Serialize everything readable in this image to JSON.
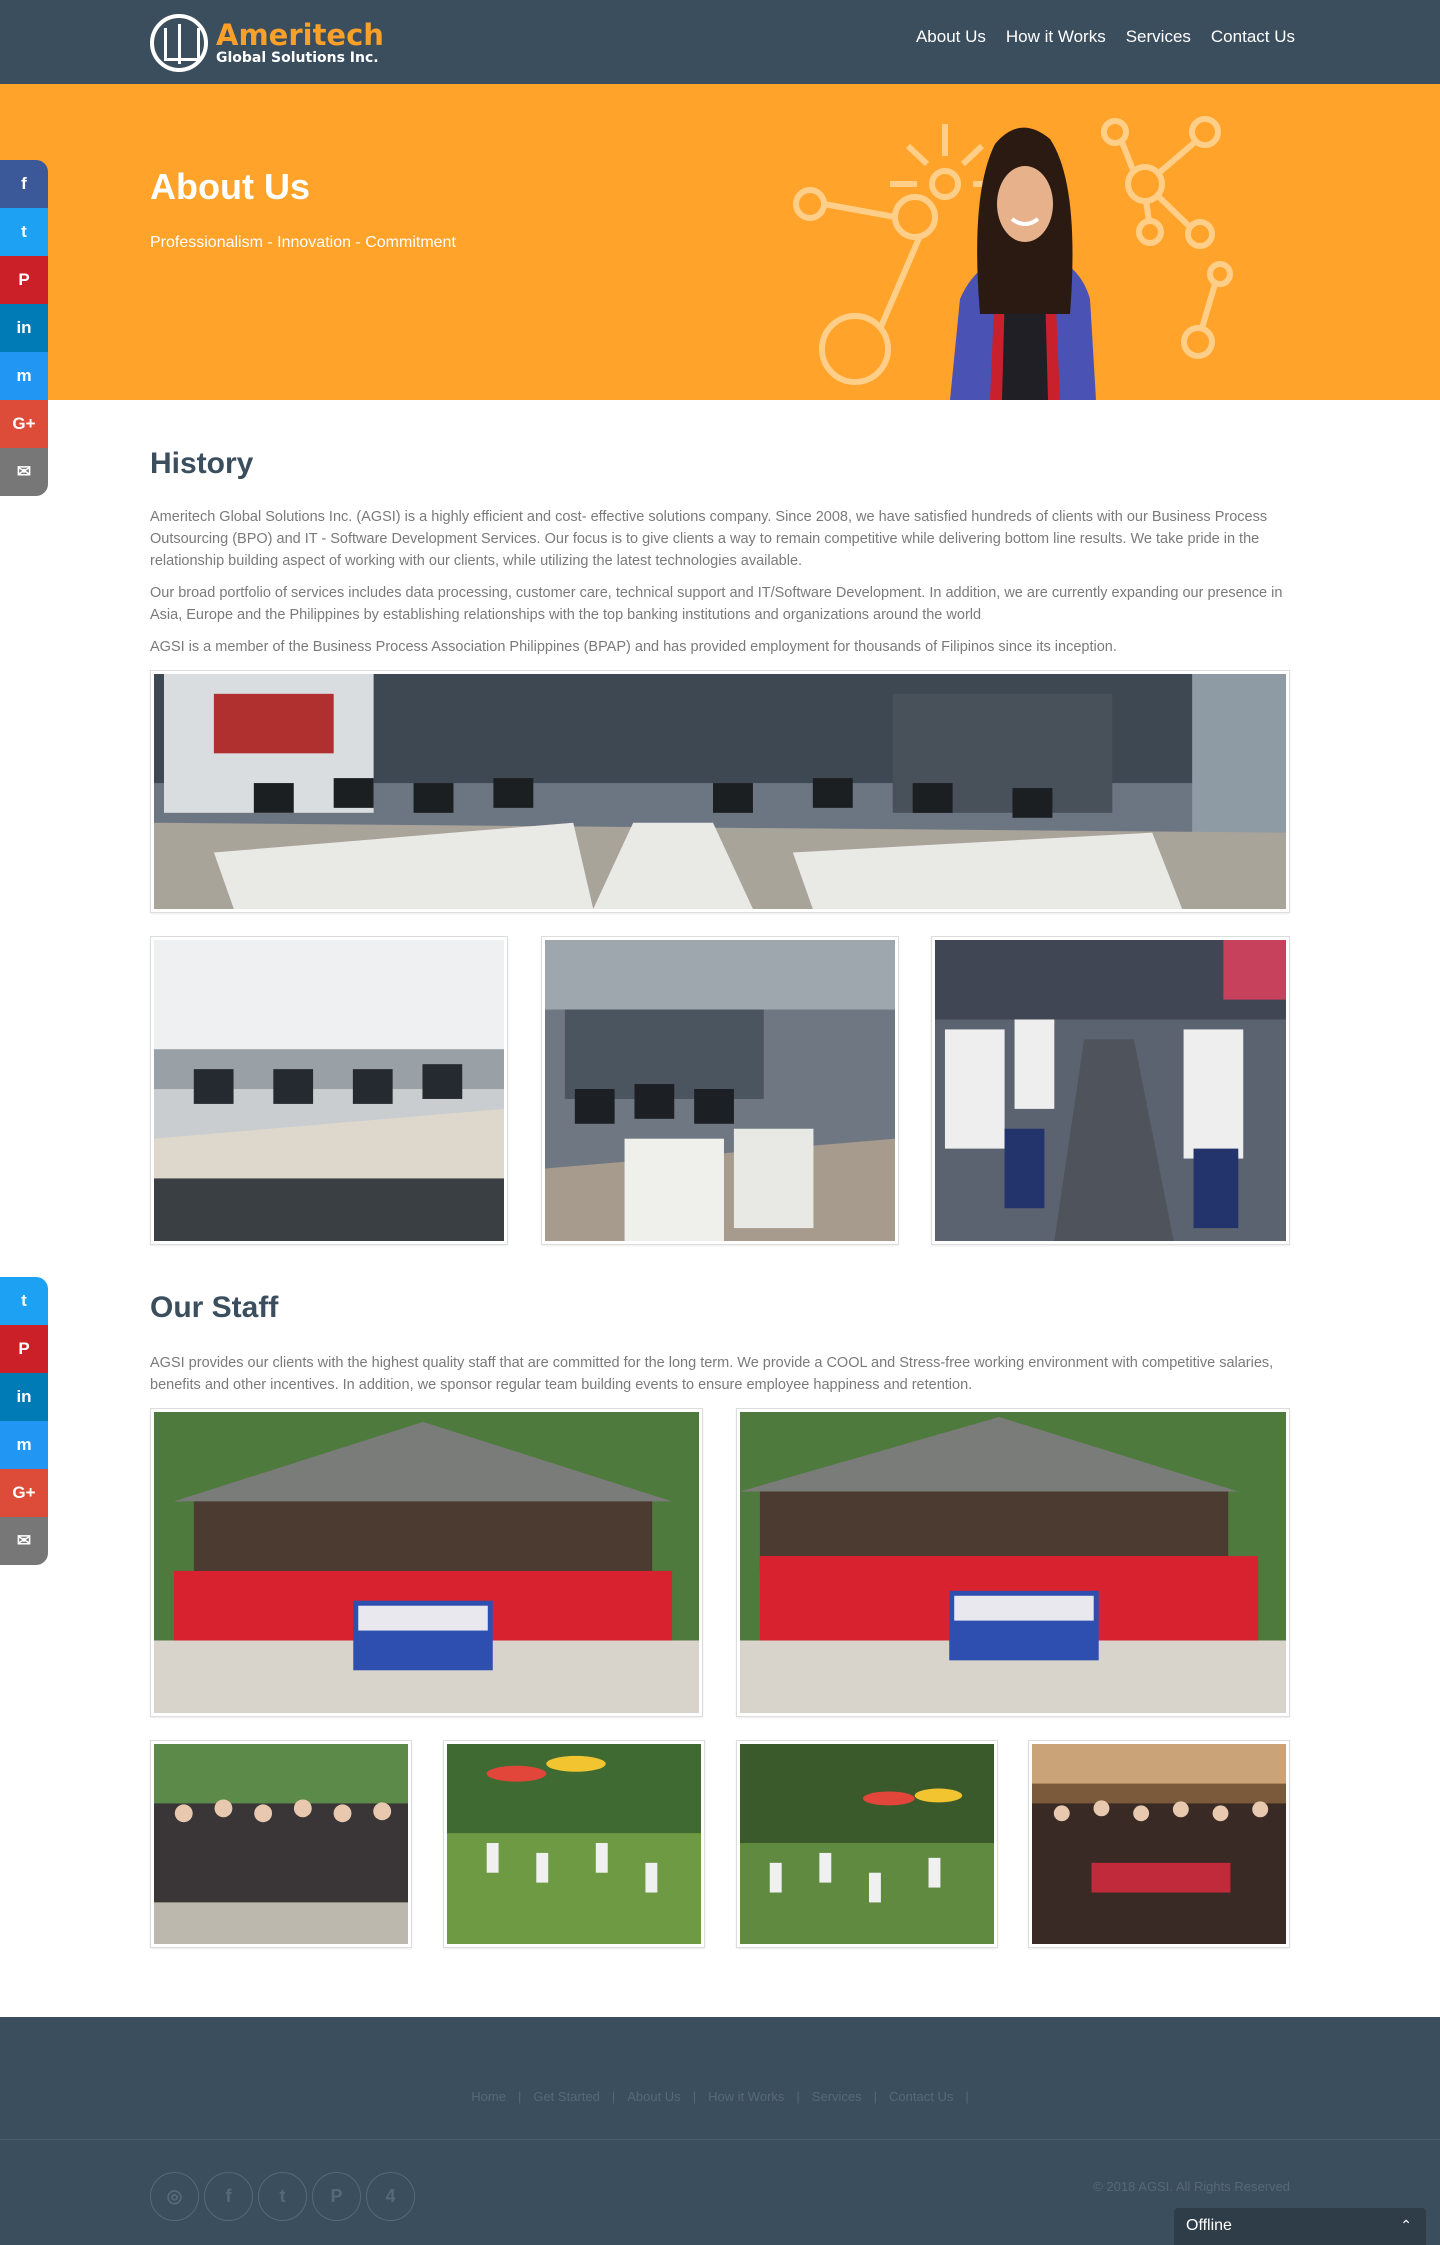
{
  "brand": {
    "name": "Ameritech",
    "subtitle": "Global Solutions Inc."
  },
  "nav": [
    "About Us",
    "How it Works",
    "Services",
    "Contact Us"
  ],
  "hero": {
    "title": "About Us",
    "tagline": "Professionalism - Innovation - Commitment"
  },
  "share_top": [
    {
      "icon": "facebook-icon",
      "glyph": "f",
      "color": "#3b5998"
    },
    {
      "icon": "twitter-icon",
      "glyph": "t",
      "color": "#1da1f2"
    },
    {
      "icon": "pinterest-icon",
      "glyph": "P",
      "color": "#cb2027"
    },
    {
      "icon": "linkedin-icon",
      "glyph": "in",
      "color": "#007bb5"
    },
    {
      "icon": "messenger-icon",
      "glyph": "m",
      "color": "#2196f3"
    },
    {
      "icon": "google-plus-icon",
      "glyph": "G+",
      "color": "#dd4b39"
    },
    {
      "icon": "email-icon",
      "glyph": "✉",
      "color": "#777777"
    }
  ],
  "share_bottom": [
    {
      "icon": "twitter-icon",
      "glyph": "t",
      "color": "#1da1f2"
    },
    {
      "icon": "pinterest-icon",
      "glyph": "P",
      "color": "#cb2027"
    },
    {
      "icon": "linkedin-icon",
      "glyph": "in",
      "color": "#007bb5"
    },
    {
      "icon": "messenger-icon",
      "glyph": "m",
      "color": "#2196f3"
    },
    {
      "icon": "google-plus-icon",
      "glyph": "G+",
      "color": "#dd4b39"
    },
    {
      "icon": "email-icon",
      "glyph": "✉",
      "color": "#777777"
    }
  ],
  "history": {
    "title": "History",
    "p1": "Ameritech Global Solutions Inc. (AGSI) is a highly efficient and cost- effective solutions company. Since 2008, we have satisfied hundreds of clients with our Business Process Outsourcing (BPO) and IT - Software Development Services. Our focus is to give clients a way to remain competitive while delivering bottom line results. We take pride in the relationship building aspect of working with our clients, while utilizing the latest technologies available.",
    "p2": "Our broad portfolio of services includes data processing, customer care, technical support and IT/Software Development. In addition, we are currently expanding our presence in Asia, Europe and the Philippines by establishing relationships with the top banking institutions and organizations around the world",
    "p3": "AGSI is a member of the Business Process Association Philippines (BPAP) and has provided employment for thousands of Filipinos since its inception."
  },
  "staff": {
    "title": "Our Staff",
    "p1": "AGSI provides our clients with the highest quality staff that are committed for the long term. We provide a COOL and Stress-free working environment with competitive salaries, benefits and other incentives. In addition, we sponsor regular team building events to ensure employee happiness and retention."
  },
  "footer": {
    "links": [
      "Home",
      "Get Started",
      "About Us",
      "How it Works",
      "Services",
      "Contact Us"
    ],
    "social": [
      {
        "icon": "instagram-icon",
        "glyph": "◎"
      },
      {
        "icon": "facebook-icon",
        "glyph": "f"
      },
      {
        "icon": "twitter-icon",
        "glyph": "t"
      },
      {
        "icon": "pinterest-icon",
        "glyph": "P"
      },
      {
        "icon": "foursquare-icon",
        "glyph": "4"
      }
    ],
    "copyright": "© 2018 AGSI. All Rights Reserved"
  },
  "chat": {
    "status": "Offline"
  }
}
